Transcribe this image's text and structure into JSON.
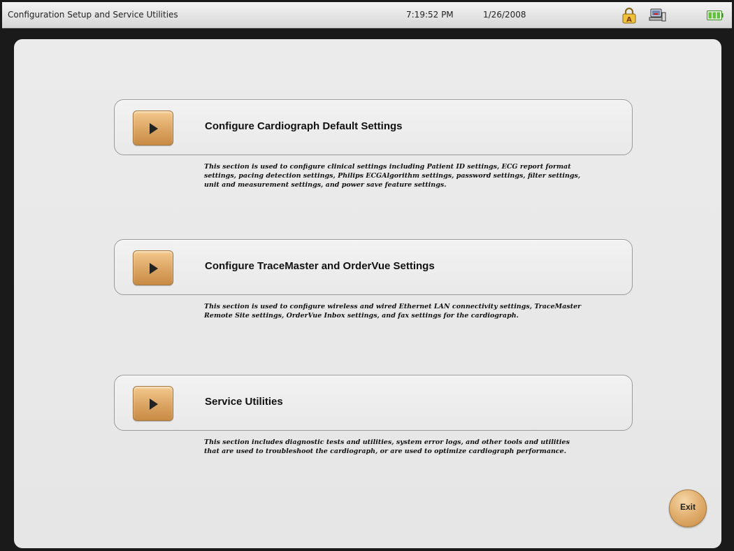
{
  "titlebar": {
    "title": "Configuration Setup and Service Utilities",
    "time": "7:19:52 PM",
    "date": "1/26/2008",
    "icons": [
      "lock-icon",
      "network-icon",
      "battery-icon"
    ]
  },
  "options": [
    {
      "label": "Configure Cardiograph Default Settings",
      "description": "This section is used to configure clinical settings including Patient ID settings, ECG report format settings, pacing detection settings, Philips ECGAlgorithm settings, password settings, filter settings, unit and measurement settings, and power save feature settings."
    },
    {
      "label": "Configure TraceMaster and OrderVue Settings",
      "description": "This section is used to configure wireless and wired Ethernet LAN connectivity settings, TraceMaster Remote Site settings, OrderVue Inbox settings, and fax settings for the cardiograph."
    },
    {
      "label": "Service Utilities",
      "description": "This section includes diagnostic tests and utilities, system error logs, and other tools and utilities that are used to troubleshoot the cardiograph, or are used to optimize cardiograph performance."
    }
  ],
  "exit_label": "Exit",
  "colors": {
    "accent_button": "#dba462",
    "panel": "#e9e9e9",
    "frame": "#1a1a1a",
    "battery": "#5fc23a"
  }
}
